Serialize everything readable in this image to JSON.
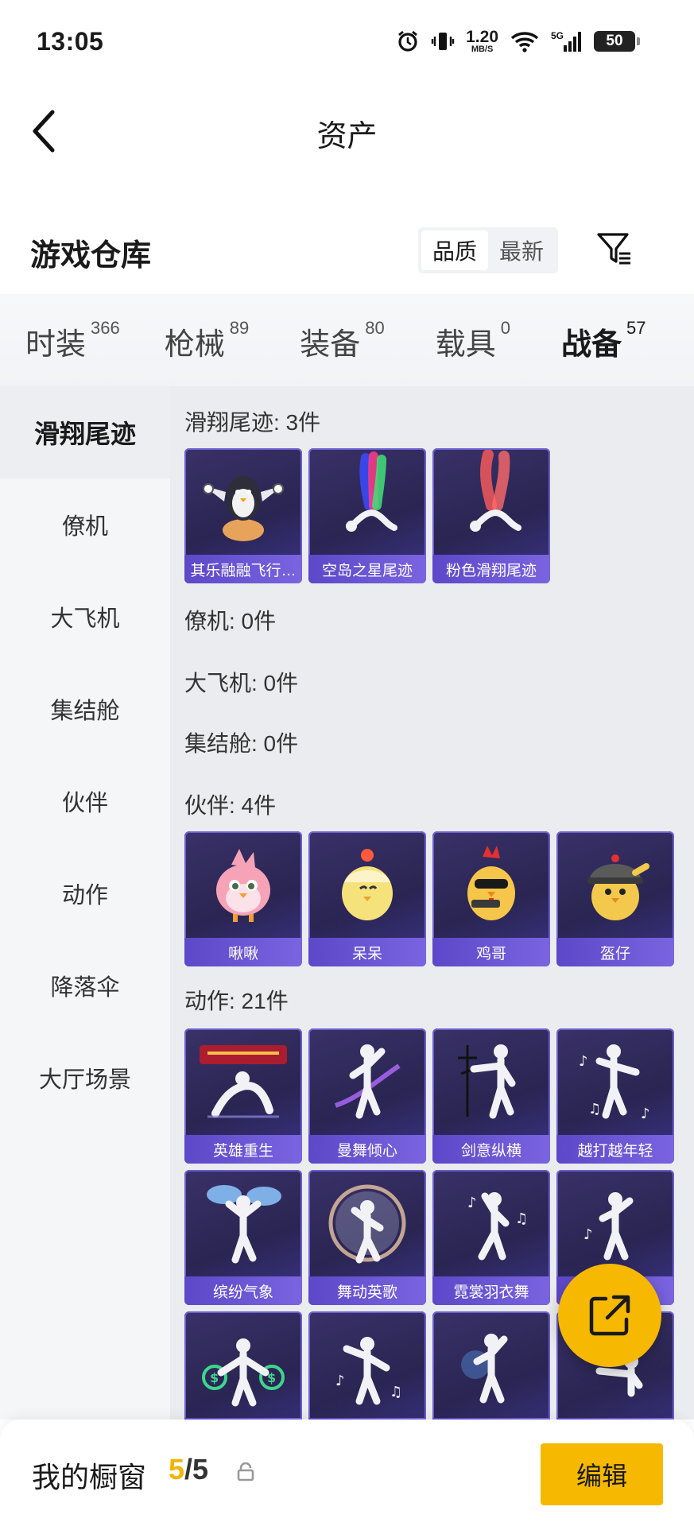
{
  "status_bar": {
    "time": "13:05",
    "net_speed_value": "1.20",
    "net_speed_unit": "MB/S",
    "battery": "50",
    "icons": [
      "alarm-icon",
      "vibrate-icon",
      "wifi-icon",
      "signal-5g-icon",
      "battery-icon"
    ]
  },
  "nav": {
    "title": "资产",
    "back_icon": "back-arrow-icon"
  },
  "section": {
    "title": "游戏仓库",
    "sort_options": [
      "品质",
      "最新"
    ],
    "active_sort": "品质",
    "filter_icon": "filter-icon"
  },
  "category_tabs": [
    {
      "label": "时装",
      "count": "366"
    },
    {
      "label": "枪械",
      "count": "89"
    },
    {
      "label": "装备",
      "count": "80"
    },
    {
      "label": "载具",
      "count": "0"
    },
    {
      "label": "战备",
      "count": "57"
    }
  ],
  "active_tab": "战备",
  "side_nav": [
    "滑翔尾迹",
    "僚机",
    "大飞机",
    "集结舱",
    "伙伴",
    "动作",
    "降落伞",
    "大厅场景"
  ],
  "active_side": "滑翔尾迹",
  "groups": {
    "trail": {
      "title": "滑翔尾迹: 3件",
      "items": [
        "其乐融融飞行…",
        "空岛之星尾迹",
        "粉色滑翔尾迹"
      ]
    },
    "wingman": {
      "title": "僚机: 0件"
    },
    "plane": {
      "title": "大飞机: 0件"
    },
    "pod": {
      "title": "集结舱: 0件"
    },
    "partner": {
      "title": "伙伴: 4件",
      "items": [
        "啾啾",
        "呆呆",
        "鸡哥",
        "盔仔"
      ]
    },
    "emote": {
      "title": "动作: 21件",
      "items": [
        "英雄重生",
        "曼舞倾心",
        "剑意纵横",
        "越打越年轻",
        "缤纷气象",
        "舞动英歌",
        "霓裳羽衣舞",
        "",
        "",
        "",
        "",
        ""
      ]
    }
  },
  "bottom_bar": {
    "label": "我的橱窗",
    "current": "5",
    "separator": "/",
    "total": "5",
    "edit_label": "编辑"
  },
  "colors": {
    "accent": "#f6b800",
    "card_bg": "#2a2552",
    "card_label": "#6a56d6",
    "content_bg": "#ebecef"
  }
}
